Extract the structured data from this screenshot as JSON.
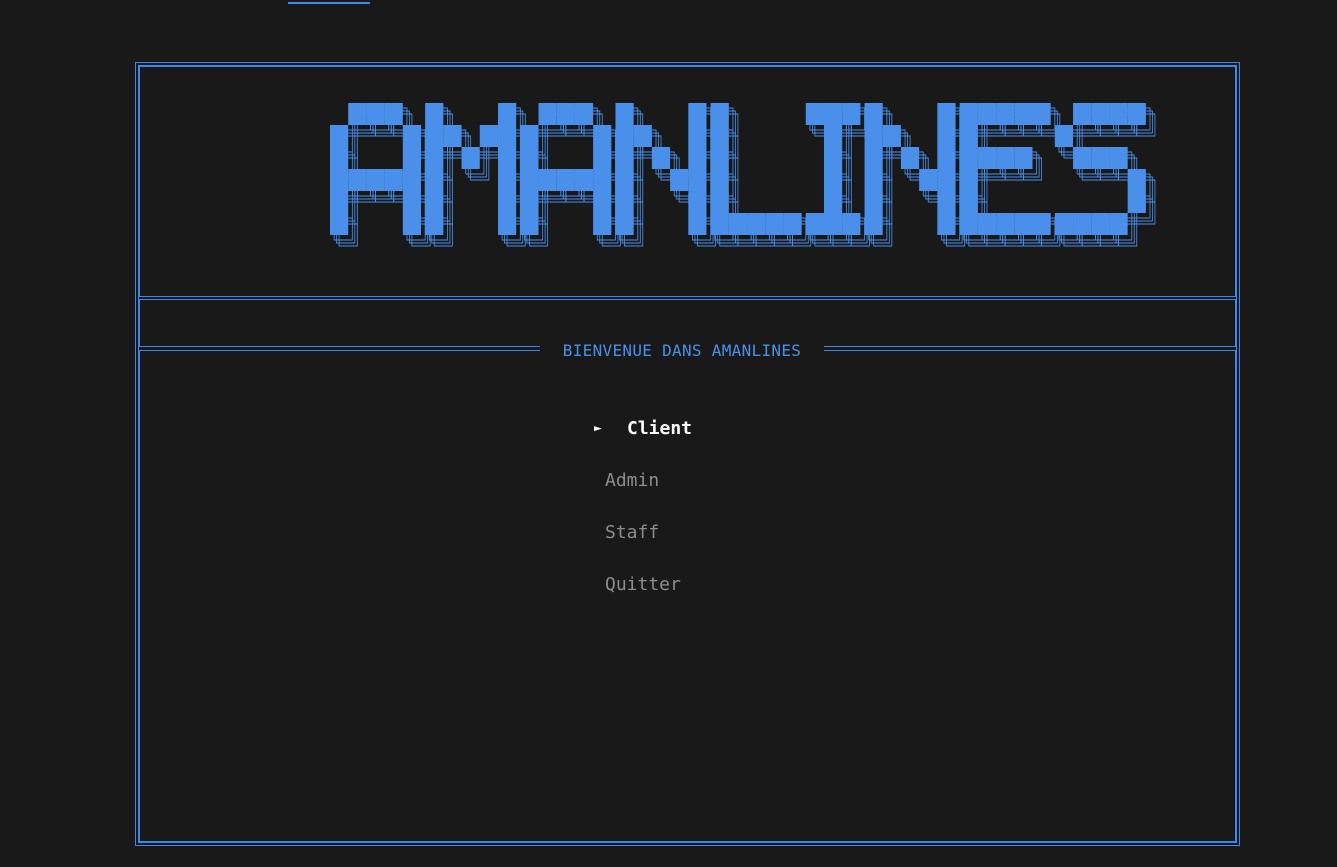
{
  "app": {
    "logo_text": "AMANLINES",
    "accent_color": "#4a90ea",
    "background_color": "#191919"
  },
  "panel": {
    "title": "BIENVENUE DANS AMANLINES"
  },
  "menu": {
    "selector_glyph": "►",
    "items": [
      {
        "label": "Client",
        "selected": true
      },
      {
        "label": "Admin",
        "selected": false
      },
      {
        "label": "Staff",
        "selected": false
      },
      {
        "label": "Quitter",
        "selected": false
      }
    ]
  }
}
